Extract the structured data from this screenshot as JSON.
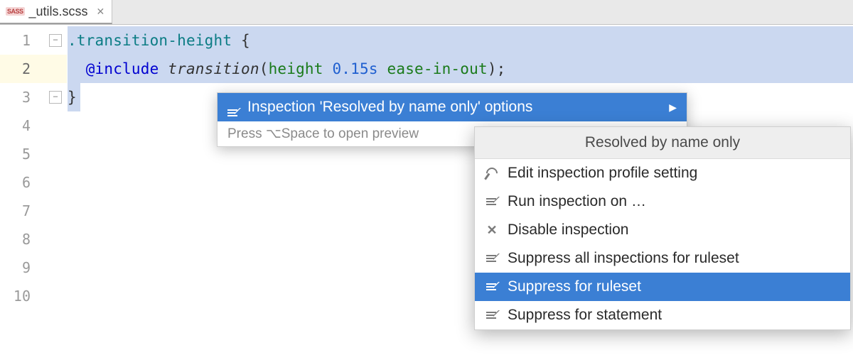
{
  "tab": {
    "badge": "SASS",
    "filename": "_utils.scss"
  },
  "gutter": {
    "lines": [
      "1",
      "2",
      "3",
      "4",
      "5",
      "6",
      "7",
      "8",
      "9",
      "10"
    ]
  },
  "code": {
    "line1": {
      "selector": ".transition-height ",
      "brace": "{"
    },
    "line2": {
      "indent": "  ",
      "at": "@include",
      "space1": " ",
      "func": "transition",
      "lp": "(",
      "p1": "height",
      "sp2": " ",
      "p2": "0.15s",
      "sp3": " ",
      "p3": "ease-in-out",
      "rp": ")",
      "semi": ";"
    },
    "line3": {
      "brace": "}"
    }
  },
  "popup1": {
    "title": "Inspection 'Resolved by name only' options",
    "hint": "Press ⌥Space to open preview"
  },
  "popup2": {
    "title": "Resolved by name only",
    "items": [
      {
        "label": "Edit inspection profile setting",
        "icon": "wrench"
      },
      {
        "label": "Run inspection on …",
        "icon": "lines-pencil"
      },
      {
        "label": "Disable inspection",
        "icon": "x"
      },
      {
        "label": "Suppress all inspections for ruleset",
        "icon": "lines-pencil"
      },
      {
        "label": "Suppress for ruleset",
        "icon": "lines-pencil",
        "selected": true
      },
      {
        "label": "Suppress for statement",
        "icon": "lines-pencil"
      }
    ]
  }
}
